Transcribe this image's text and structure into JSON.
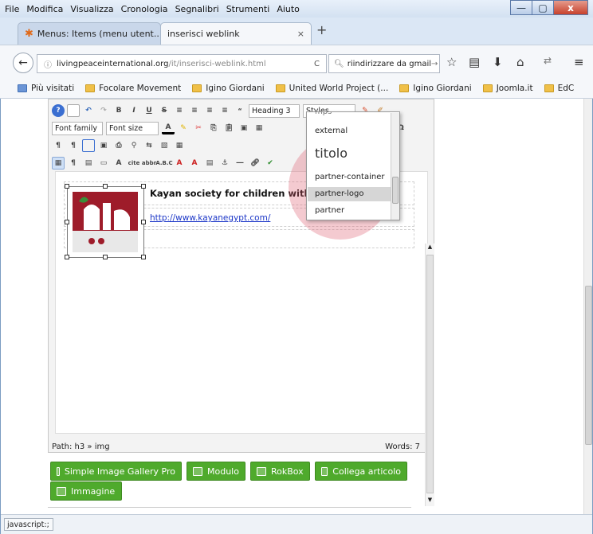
{
  "menubar": {
    "items": [
      {
        "label": "File",
        "u": "F"
      },
      {
        "label": "Modifica",
        "u": "M"
      },
      {
        "label": "Visualizza",
        "u": "V"
      },
      {
        "label": "Cronologia",
        "u": "C"
      },
      {
        "label": "Segnalibri",
        "u": "S"
      },
      {
        "label": "Strumenti",
        "u": "S"
      },
      {
        "label": "Aiuto",
        "u": "A"
      }
    ]
  },
  "window": {
    "minimize": "—",
    "maximize": "▢",
    "close": "x"
  },
  "tabs": [
    {
      "label": "Menus: Items (menu utent...",
      "close": "×"
    },
    {
      "label": "inserisci weblink",
      "close": "×"
    }
  ],
  "newtab": "+",
  "nav": {
    "back": "←",
    "url_host": "livingpeaceinternational.org",
    "url_path": "/it/inserisci-weblink.html",
    "reload": "C",
    "search_value": "riindirizzare da gmail",
    "search_go": "→"
  },
  "bookmarks": [
    "Più visitati",
    "Focolare Movement",
    "Igino Giordani",
    "United World Project (...",
    "Igino Giordani",
    "Joomla.it",
    "EdC"
  ],
  "editor": {
    "heading_select": "Heading 3",
    "styles_select": "Styles",
    "font_family": "Font family",
    "font_size": "Font size",
    "omega": "Ω",
    "content": {
      "heading": "Kayan society for children with di",
      "link": "http://www.kayanegypt.com/"
    },
    "path": "Path:  h3 » img",
    "words": "Words: 7"
  },
  "styles_dropdown": {
    "items": [
      "mps",
      "external",
      "titolo",
      "partner-container",
      "partner-logo",
      "partner"
    ],
    "selected": "partner-logo"
  },
  "buttons": [
    {
      "label": "Simple Image Gallery Pro"
    },
    {
      "label": "Modulo"
    },
    {
      "label": "RokBox"
    },
    {
      "label": "Collega articolo"
    },
    {
      "label": "Immagine"
    }
  ],
  "status": {
    "text": "javascript:;"
  },
  "colors": {
    "button_green": "#4faa2c",
    "link": "#1a35c7",
    "highlight": "#dc5a6e"
  }
}
